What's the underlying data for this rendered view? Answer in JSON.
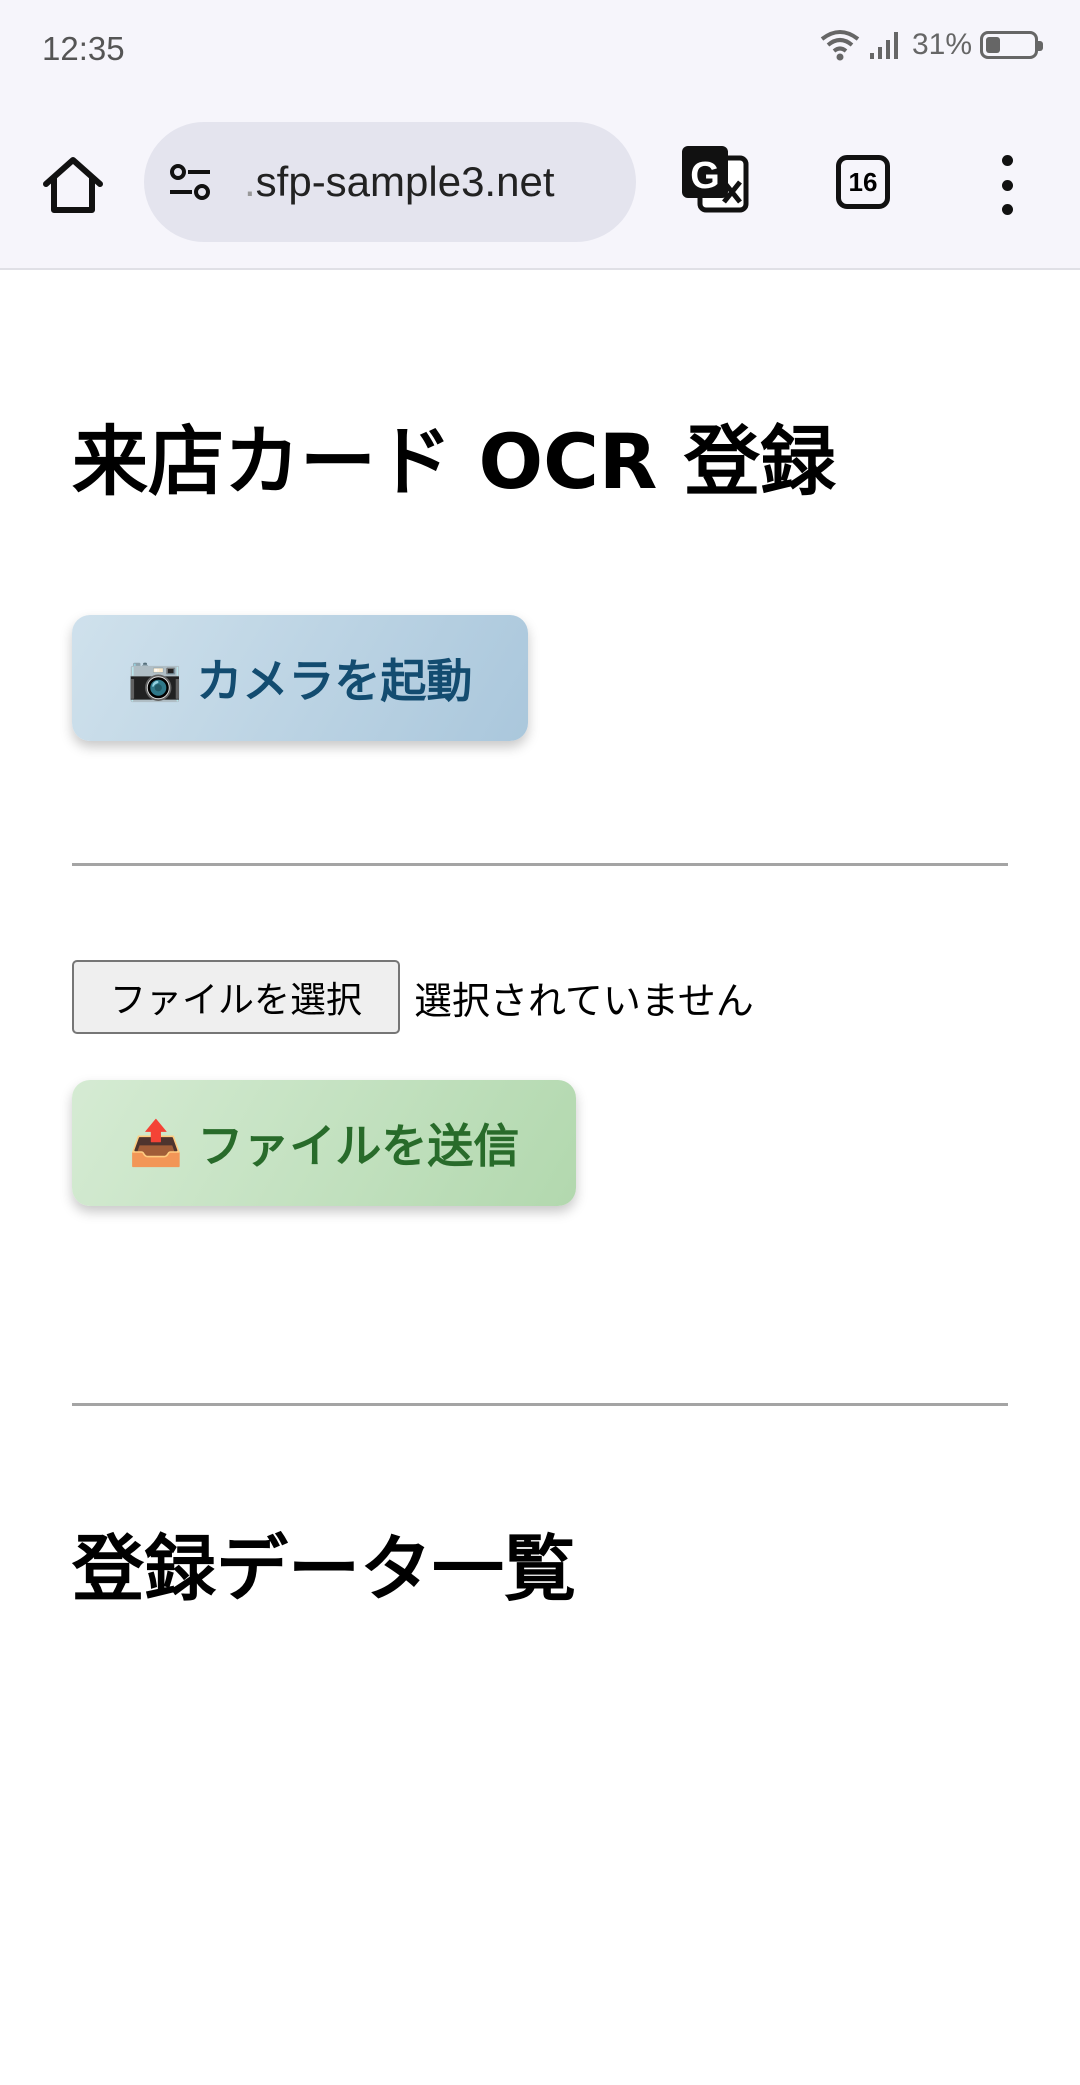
{
  "status_bar": {
    "time": "12:35",
    "battery": "31%"
  },
  "browser": {
    "url_prefix": ".",
    "url_domain": "sfp-sample3.net",
    "tab_count": "16"
  },
  "page": {
    "title": "来店カード OCR 登録",
    "camera_button": {
      "emoji": "📷",
      "label": "カメラを起動"
    },
    "file_input": {
      "button_label": "ファイルを選択",
      "status": "選択されていません"
    },
    "upload_button": {
      "emoji": "📤",
      "label": "ファイルを送信"
    },
    "list_heading": "登録データ一覧"
  },
  "colors": {
    "camera_text": "#134c70",
    "upload_text": "#286b2a"
  }
}
